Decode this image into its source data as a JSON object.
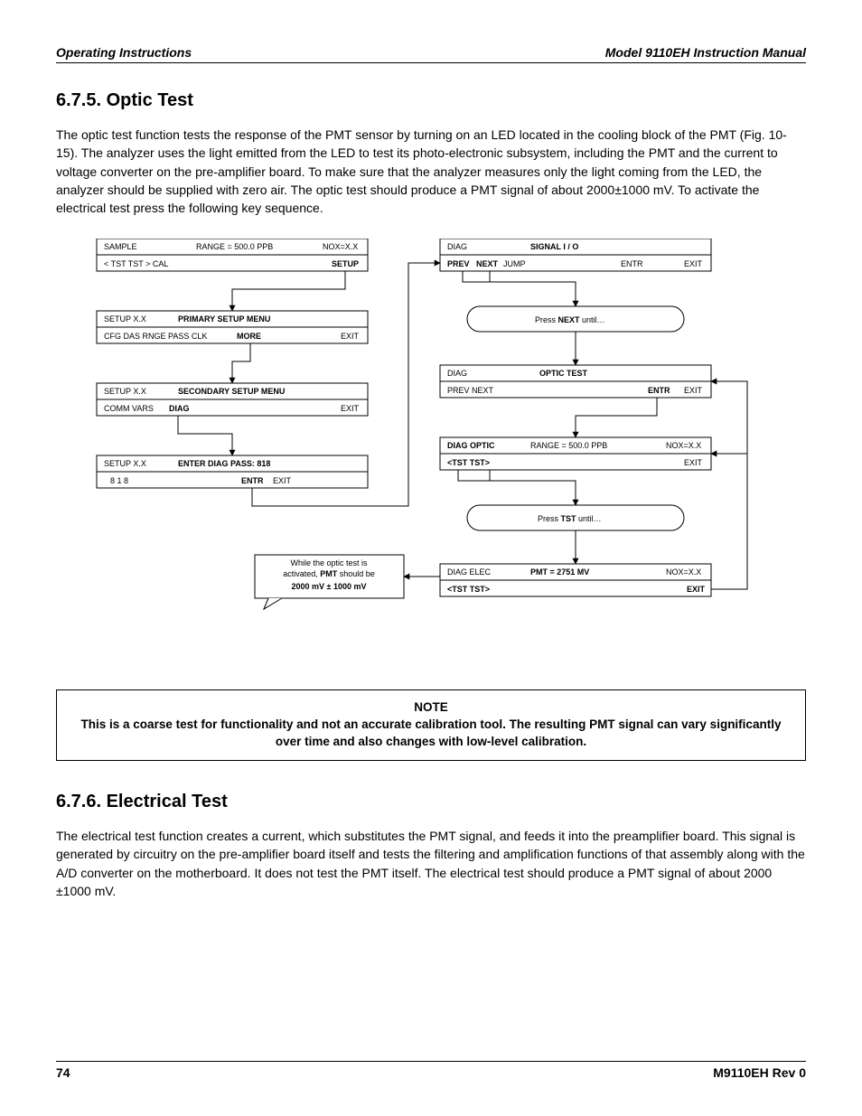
{
  "header": {
    "left": "Operating Instructions",
    "right": "Model 9110EH Instruction Manual"
  },
  "section1": {
    "title": "6.7.5. Optic Test",
    "paragraph": "The optic test function tests the response of the PMT sensor by turning on an LED located in the cooling block of the PMT (Fig. 10-15). The analyzer uses the light emitted from the LED to test its photo-electronic subsystem, including the PMT and the current to voltage converter on the pre-amplifier board. To make sure that the analyzer measures only the light coming from the LED, the analyzer should be supplied with zero air. The optic test should produce a PMT signal of about 2000±1000 mV. To activate the electrical test press the following key sequence."
  },
  "diagram": {
    "box_a": {
      "l1_left": "SAMPLE",
      "l1_mid": "RANGE = 500.0 PPB",
      "l1_right": "NOX=X.X",
      "l2_left": "< TST  TST >  CAL",
      "l2_right": "SETUP"
    },
    "box_b": {
      "l1_left": "SETUP X.X",
      "l1_mid": "PRIMARY SETUP MENU",
      "l2_left": "CFG  DAS  RNGE  PASS  CLK",
      "l2_bold": "MORE",
      "l2_right": "EXIT"
    },
    "box_c": {
      "l1_left": "SETUP X.X",
      "l1_mid": "SECONDARY SETUP MENU",
      "l2_left": "COMM  VARS",
      "l2_bold": "DIAG",
      "l2_right": "EXIT"
    },
    "box_d": {
      "l1_left": "SETUP X.X",
      "l1_mid": "ENTER DIAG PASS: 818",
      "l2_left": "8    1    8",
      "l2_bold": "ENTR",
      "l2_right": "EXIT"
    },
    "box_e": {
      "l1_left": "DIAG",
      "l1_mid": "SIGNAL I / O",
      "l2_lp": "PREV",
      "l2_lb": "NEXT",
      "l2_lj": "JUMP",
      "l2_entr": "ENTR",
      "l2_right": "EXIT"
    },
    "bubble_f": {
      "pre": "Press ",
      "bold": "NEXT",
      "post": " until…"
    },
    "box_g": {
      "l1_left": "DIAG",
      "l1_mid": "OPTIC TEST",
      "l2_left": "PREV  NEXT",
      "l2_bold": "ENTR",
      "l2_right": "EXIT"
    },
    "box_h": {
      "l1_left": "DIAG OPTIC",
      "l1_mid": "RANGE = 500.0 PPB",
      "l1_right": "NOX=X.X",
      "l2_left": "<TST   TST>",
      "l2_right": "EXIT"
    },
    "bubble_i": {
      "pre": "Press ",
      "bold": "TST",
      "post": " until…"
    },
    "box_j": {
      "l1_left": "DIAG ELEC",
      "l1_mid": "PMT = 2751  MV",
      "l1_right": "NOX=X.X",
      "l2_left": "<TST   TST>",
      "l2_right": "EXIT"
    },
    "callout": {
      "l1": "While the optic test is",
      "l2a": "activated,  ",
      "l2b": "PMT",
      "l2c": " should be",
      "l3": "2000 mV ± 1000 mV"
    }
  },
  "note": {
    "title": "NOTE",
    "body": "This is a coarse test for functionality and not an accurate calibration tool. The resulting PMT signal can vary significantly over time and also changes with low-level calibration."
  },
  "section2": {
    "title": "6.7.6. Electrical Test",
    "paragraph": "The electrical test function creates a current, which substitutes the PMT signal, and feeds it into the preamplifier board. This signal is generated by circuitry on the pre-amplifier board itself and tests the filtering and amplification functions of that assembly along with the A/D converter on the motherboard. It does not test the PMT itself. The electrical test should produce a PMT signal of about 2000 ±1000 mV."
  },
  "footer": {
    "page": "74",
    "rev": "M9110EH Rev 0"
  }
}
